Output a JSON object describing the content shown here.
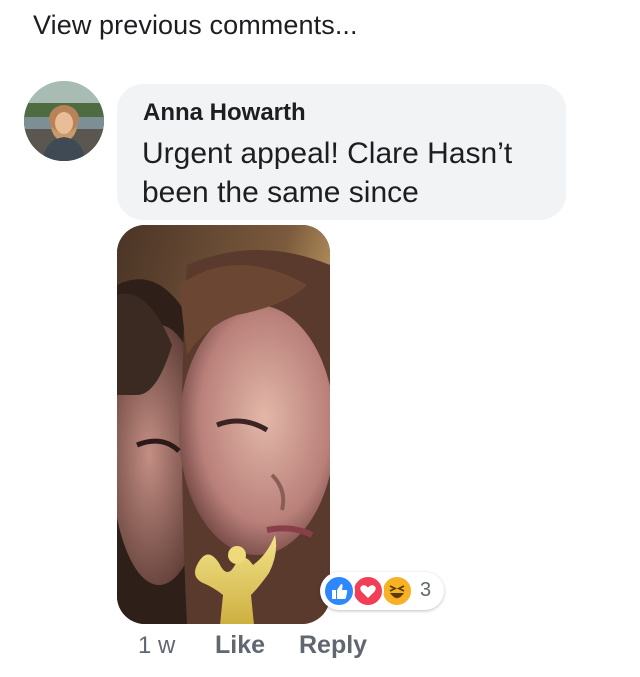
{
  "thread": {
    "view_previous_label": "View previous comments..."
  },
  "comment": {
    "author": "Anna Howarth",
    "text": "Urgent appeal! Clare Hasn’t been the same since",
    "time": "1 w",
    "like_label": "Like",
    "reply_label": "Reply",
    "avatar_icon": "profile-photo",
    "attachment_icon": "photo-attachment"
  },
  "reactions": {
    "types": [
      "like-icon",
      "love-icon",
      "haha-icon"
    ],
    "count": "3",
    "colors": {
      "like": "#2d88ff",
      "love": "#f33e58",
      "haha": "#f7b125"
    }
  },
  "colors": {
    "bubble": "#f2f3f5",
    "text": "#1c1e21",
    "secondary": "#606770"
  }
}
